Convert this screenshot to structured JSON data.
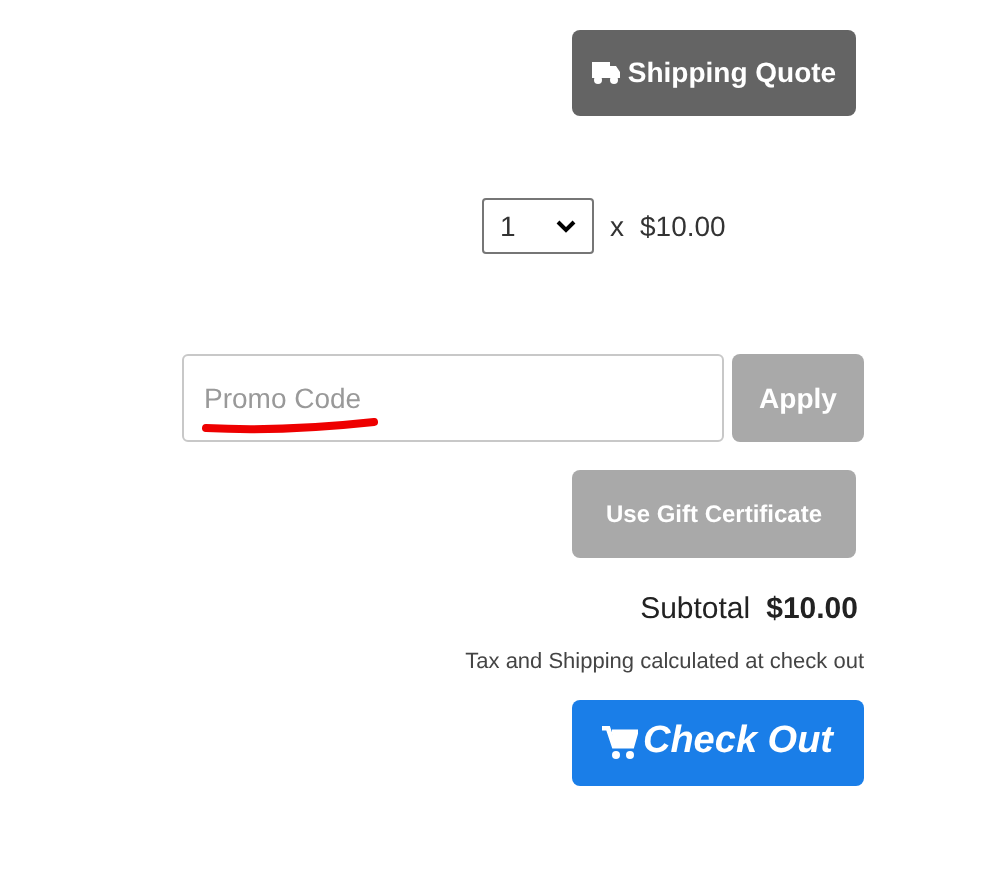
{
  "shipping_button": {
    "label": "Shipping Quote"
  },
  "quantity": {
    "value": "1",
    "multiplier": "x",
    "unit_price": "$10.00"
  },
  "promo": {
    "placeholder": "Promo Code"
  },
  "apply_button": {
    "label": "Apply",
    "disabled": true
  },
  "gift_button": {
    "label": "Use Gift Certificate",
    "disabled": true
  },
  "subtotal": {
    "label": "Subtotal",
    "amount": "$10.00"
  },
  "note": "Tax and Shipping calculated at check out",
  "checkout_button": {
    "label": "Check Out"
  }
}
